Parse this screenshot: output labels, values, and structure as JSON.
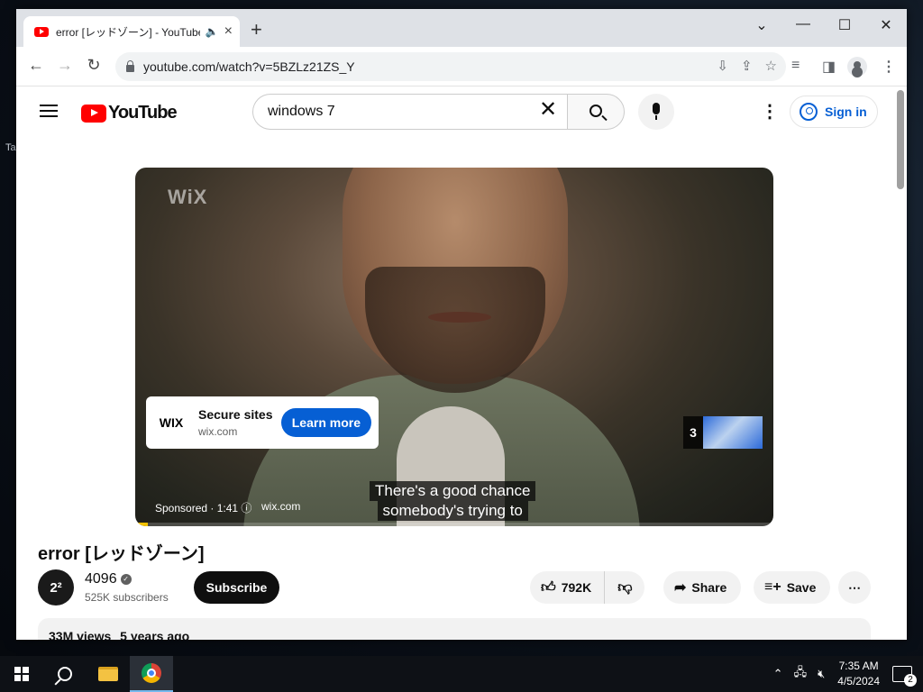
{
  "desktop": {
    "stray_text": "Ta"
  },
  "browser": {
    "tab": {
      "title": "error [レッドゾーン] - YouTube",
      "audio_icon": "speaker-icon"
    },
    "url": "youtube.com/watch?v=5BZLz21ZS_Y",
    "window_controls": {
      "chevron": "⌄",
      "minimize": "—",
      "maximize": "☐",
      "close": "✕"
    }
  },
  "youtube": {
    "logo_text": "YouTube",
    "search": {
      "value": "windows 7"
    },
    "sign_in": "Sign in",
    "player": {
      "watermark": "WiX",
      "ad_card": {
        "logo": "WIX",
        "title": "Secure sites",
        "domain": "wix.com",
        "cta": "Learn more"
      },
      "ad_queue_count": "3",
      "captions": [
        "There's a good chance",
        "somebody's trying to"
      ],
      "sponsored": "Sponsored · 1:41 ⓘ",
      "ad_url": "wix.com",
      "ad_progress": 0.02
    },
    "video": {
      "title": "error [レッドゾーン]",
      "channel": {
        "avatar": "2²",
        "name": "4096",
        "subscribers": "525K subscribers"
      },
      "subscribe": "Subscribe",
      "likes": "792K",
      "share": "Share",
      "save": "Save",
      "views": "33M views",
      "age": "5 years ago"
    }
  },
  "taskbar": {
    "time": "7:35 AM",
    "date": "4/5/2024",
    "notifications": "2"
  }
}
